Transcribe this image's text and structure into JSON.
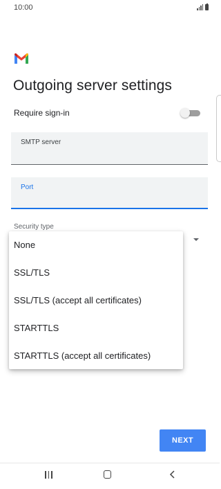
{
  "status_bar": {
    "time": "10:00",
    "icons": [
      "signal-icon",
      "battery-icon"
    ]
  },
  "app": {
    "logo": "gmail-logo"
  },
  "page": {
    "title": "Outgoing server settings"
  },
  "require_signin": {
    "label": "Require sign-in",
    "enabled": false
  },
  "smtp_field": {
    "label": "SMTP server",
    "value": ""
  },
  "port_field": {
    "label": "Port",
    "value": ""
  },
  "security": {
    "label": "Security type",
    "options": [
      "None",
      "SSL/TLS",
      "SSL/TLS (accept all certificates)",
      "STARTTLS",
      "STARTTLS (accept all certificates)"
    ]
  },
  "actions": {
    "next_label": "NEXT"
  },
  "nav_bar": {
    "icons": [
      "recents-icon",
      "home-icon",
      "back-icon"
    ]
  },
  "colors": {
    "accent": "#1a73e8",
    "button": "#4285f4",
    "field_bg": "#f1f3f4"
  }
}
